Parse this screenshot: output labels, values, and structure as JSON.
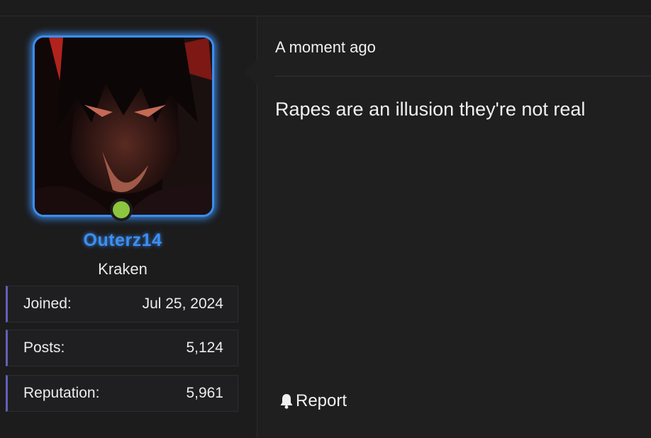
{
  "user": {
    "name": "Outerz14",
    "title": "Kraken",
    "avatar_description_icon": "user-avatar-image",
    "online": true,
    "stats": [
      {
        "label": "Joined:",
        "value": "Jul 25, 2024"
      },
      {
        "label": "Posts:",
        "value": "5,124"
      },
      {
        "label": "Reputation:",
        "value": "5,961"
      }
    ]
  },
  "post": {
    "time": "A moment ago",
    "message": "Rapes are an illusion they're not real",
    "report_label": "Report",
    "report_icon": "bell-icon"
  },
  "colors": {
    "background": "#1f1f20",
    "accent_username": "#3d8ff2",
    "avatar_border": "#3b8ef0",
    "online": "#8cc63f",
    "stat_bar": "#6160b8"
  }
}
